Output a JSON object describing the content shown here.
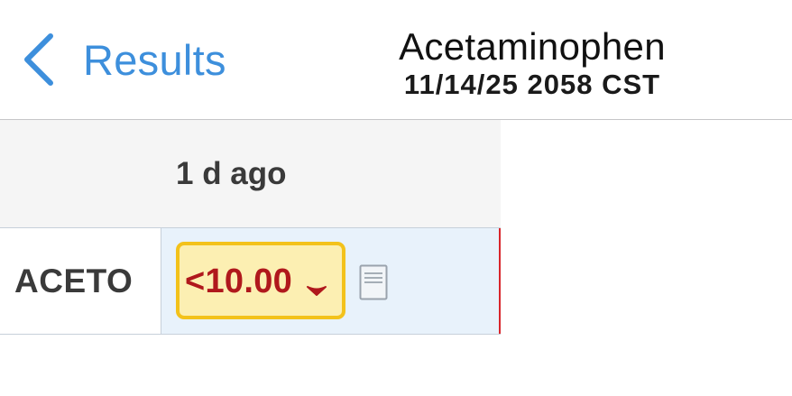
{
  "nav": {
    "back_label": "Results",
    "title": "Acetaminophen",
    "subtitle": "11/14/25 2058 CST"
  },
  "grid": {
    "column_header": "1 d ago",
    "rows": [
      {
        "label": "ACETO",
        "value": "<10.00",
        "flag": "low",
        "flag_icon": "down-arrow-icon",
        "note_icon": "document-icon"
      }
    ]
  },
  "colors": {
    "accent": "#3d8fdc",
    "abnormal_text": "#b0181c",
    "abnormal_highlight": "#fcefb2",
    "abnormal_border": "#f3c21b",
    "critical_line": "#d8262b"
  }
}
